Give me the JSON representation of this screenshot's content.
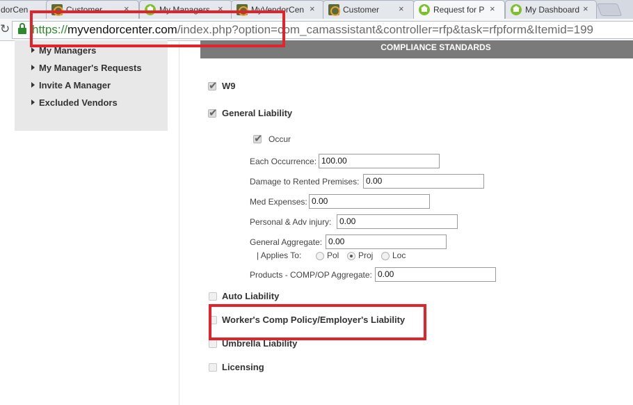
{
  "browser": {
    "tabs": [
      {
        "title": "dorCen",
        "icon": "joomla-icon"
      },
      {
        "title": "Customer",
        "icon": "joomla-icon"
      },
      {
        "title": "My Managers",
        "icon": "home-icon"
      },
      {
        "title": "MyVendorCen",
        "icon": "joomla-icon"
      },
      {
        "title": "Customer",
        "icon": "joomla-icon"
      },
      {
        "title": "Request for Pro",
        "icon": "home-icon"
      },
      {
        "title": "My Dashboard",
        "icon": "home-icon"
      }
    ],
    "close_glyph": "×",
    "reload_glyph": "↻",
    "url": {
      "scheme": "https://",
      "host": "myvendorcenter.com",
      "path": "/index.php?option=com_camassistant&controller=rfp&task=rfpform&Itemid=199"
    }
  },
  "sidebar": {
    "items": [
      {
        "label": "My Managers"
      },
      {
        "label": "My Manager's Requests"
      },
      {
        "label": "Invite A Manager"
      },
      {
        "label": "Excluded Vendors"
      }
    ]
  },
  "compliance": {
    "header": "COMPLIANCE STANDARDS",
    "w9": {
      "label": "W9",
      "checked": true
    },
    "general_liability": {
      "label": "General Liability",
      "checked": true,
      "occur": {
        "label": "Occur",
        "checked": true
      },
      "fields": {
        "each_occurrence": {
          "label": "Each Occurrence:",
          "value": "100.00"
        },
        "damage_rented": {
          "label": "Damage to Rented Premises:",
          "value": "0.00"
        },
        "med_expenses": {
          "label": "Med Expenses:",
          "value": "0.00"
        },
        "personal_adv": {
          "label": "Personal & Adv injury:",
          "value": "0.00"
        },
        "general_aggregate": {
          "label": "General Aggregate:",
          "value": "0.00"
        },
        "products_comp": {
          "label": "Products - COMP/OP Aggregate:",
          "value": "0.00"
        }
      },
      "applies_to": {
        "label": "| Applies To:",
        "options": [
          {
            "label": "Pol",
            "selected": false
          },
          {
            "label": "Proj",
            "selected": true
          },
          {
            "label": "Loc",
            "selected": false
          }
        ]
      }
    },
    "auto_liability": {
      "label": "Auto Liability",
      "checked": false
    },
    "workers_comp": {
      "label": "Worker's Comp Policy/Employer's Liability",
      "checked": false
    },
    "umbrella": {
      "label": "Umbrella Liability",
      "checked": false
    },
    "licensing": {
      "label": "Licensing",
      "checked": false
    }
  },
  "colors": {
    "annotation": "#e3232c",
    "secure_green": "#2f8a2f",
    "header_bg": "#7a7a7a"
  }
}
